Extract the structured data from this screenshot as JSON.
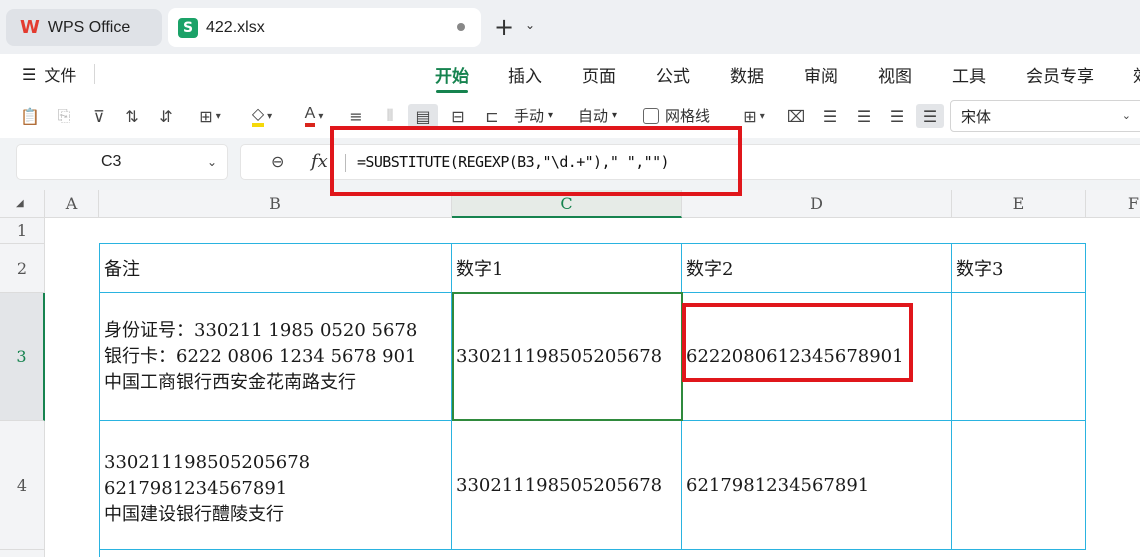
{
  "tabs": {
    "home_label": "WPS Office",
    "home_icon": "W",
    "doc_label": "422.xlsx",
    "doc_icon": "S",
    "new_tab": "+"
  },
  "menu": {
    "file_label": "文件",
    "hamburger": "☰",
    "tabs": [
      "开始",
      "插入",
      "页面",
      "公式",
      "数据",
      "审阅",
      "视图",
      "工具",
      "会员专享",
      "效"
    ],
    "active_tab": "开始"
  },
  "toolbar": {
    "fill_label": "手动",
    "auto_label": "自动",
    "gridlines_label": "网格线",
    "font_name": "宋体",
    "font_color": "#d9251c",
    "highlight_color": "#f5d90a"
  },
  "formula_bar": {
    "cell_ref": "C3",
    "fx_label": "fx",
    "formula": "=SUBSTITUTE(REGEXP(B3,\"\\d.+\"),\" \",\"\")"
  },
  "grid": {
    "columns": [
      "A",
      "B",
      "C",
      "D",
      "E",
      "F"
    ],
    "selected_column": "C",
    "rows": [
      "1",
      "2",
      "3",
      "4"
    ],
    "selected_row": "3",
    "header_row": [
      "备注",
      "数字1",
      "数字2",
      "数字3"
    ],
    "row3": {
      "B": [
        "身份证号：330211 1985 0520 5678",
        "银行卡：6222 0806 1234 5678 901",
        "中国工商银行西安金花南路支行"
      ],
      "C": "330211198505205678",
      "D": "6222080612345678901",
      "E": ""
    },
    "row4": {
      "B": [
        "330211198505205678",
        "6217981234567891",
        "中国建设银行醴陵支行"
      ],
      "C": "330211198505205678",
      "D": "6217981234567891",
      "E": ""
    }
  },
  "colors": {
    "accent": "#16834f",
    "annotation": "#e0161b",
    "table_border": "#2ab3e0"
  }
}
